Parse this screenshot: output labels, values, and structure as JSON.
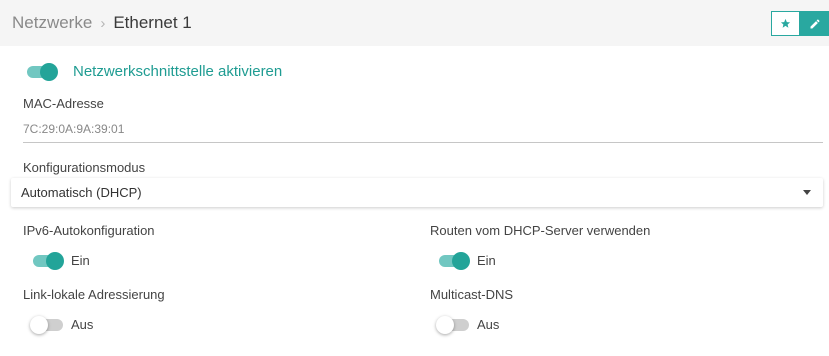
{
  "header": {
    "breadcrumb_parent": "Netzwerke",
    "breadcrumb_separator": "›",
    "breadcrumb_current": "Ethernet 1",
    "actions": [
      {
        "icon": "star-icon"
      },
      {
        "icon": "pencil-icon"
      }
    ]
  },
  "interface": {
    "enable_label": "Netzwerkschnittstelle aktivieren",
    "enabled": true
  },
  "mac": {
    "label": "MAC-Adresse",
    "value": "7C:29:0A:9A:39:01"
  },
  "config_mode": {
    "label": "Konfigurationsmodus",
    "selected": "Automatisch (DHCP)"
  },
  "ipv6": {
    "label": "IPv6-Autokonfiguration",
    "state_label": "Ein",
    "enabled": true
  },
  "dhcp_routes": {
    "label": "Routen vom DHCP-Server verwenden",
    "state_label": "Ein",
    "enabled": true
  },
  "link_local": {
    "label": "Link-lokale Adressierung",
    "state_label": "Aus",
    "enabled": false
  },
  "mdns": {
    "label": "Multicast-DNS",
    "state_label": "Aus",
    "enabled": false
  },
  "colors": {
    "accent": "#23a499",
    "accent_light": "#71c7c1",
    "header_bg": "#f5f5f5"
  }
}
